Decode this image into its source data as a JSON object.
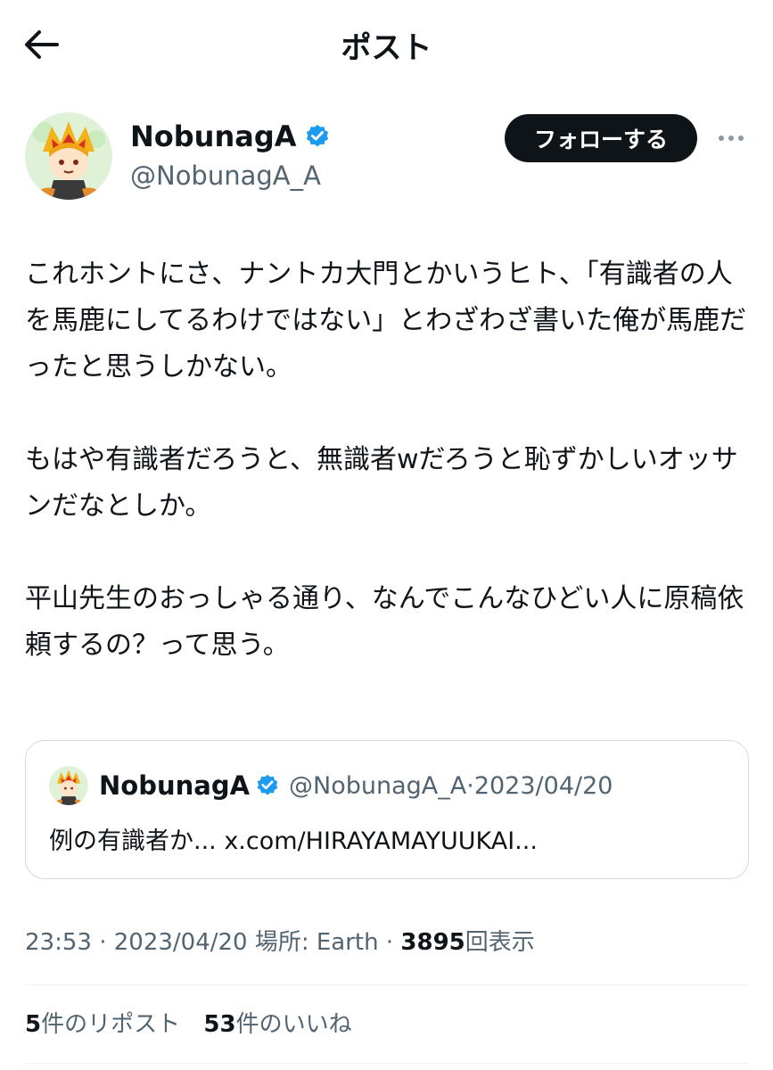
{
  "header": {
    "title": "ポスト",
    "back_icon": "arrow-left-icon"
  },
  "author": {
    "display_name": "NobunagA",
    "handle": "@NobunagA_A",
    "verified_icon": "verified-badge-icon",
    "verified_color": "#1d9bf0",
    "follow_label": "フォローする",
    "more_icon": "more-horizontal-icon"
  },
  "tweet": {
    "paragraphs": [
      "これホントにさ、ナントカ大門とかいうヒト、「有識者の人を馬鹿にしてるわけではない」とわざわざ書いた俺が馬鹿だったと思うしかない。",
      "もはや有識者だろうと、無識者wだろうと恥ずかしいオッサンだなとしか。",
      "平山先生のおっしゃる通り、なんでこんなひどい人に原稿依頼するの？って思う。"
    ]
  },
  "quote": {
    "display_name": "NobunagA",
    "handle": "@NobunagA_A",
    "separator": "·",
    "date": "2023/04/20",
    "text": "例の有識者か... x.com/HIRAYAMAYUUKAI..."
  },
  "meta": {
    "time": "23:53",
    "sep1": "·",
    "date": "2023/04/20",
    "location": "場所: Earth",
    "sep2": "·",
    "views": "3895",
    "views_label": "回表示"
  },
  "stats": {
    "reposts_count": "5",
    "reposts_label": "件のリポスト",
    "likes_count": "53",
    "likes_label": "件のいいね"
  },
  "colors": {
    "text": "#0f1419",
    "secondary": "#536471",
    "border": "#cfd9de",
    "accent": "#1d9bf0"
  }
}
